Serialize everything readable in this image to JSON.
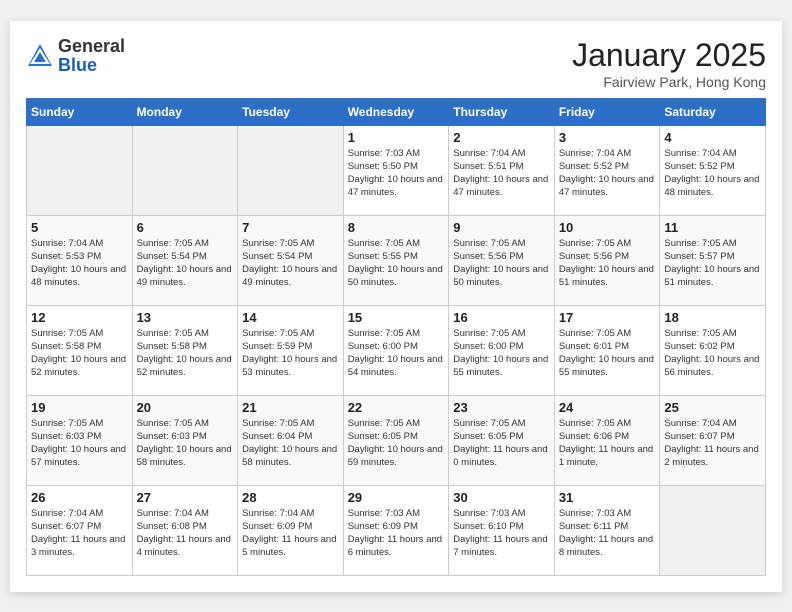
{
  "header": {
    "logo_general": "General",
    "logo_blue": "Blue",
    "month_year": "January 2025",
    "location": "Fairview Park, Hong Kong"
  },
  "days_of_week": [
    "Sunday",
    "Monday",
    "Tuesday",
    "Wednesday",
    "Thursday",
    "Friday",
    "Saturday"
  ],
  "weeks": [
    [
      {
        "day": "",
        "sunrise": "",
        "sunset": "",
        "daylight": ""
      },
      {
        "day": "",
        "sunrise": "",
        "sunset": "",
        "daylight": ""
      },
      {
        "day": "",
        "sunrise": "",
        "sunset": "",
        "daylight": ""
      },
      {
        "day": "1",
        "sunrise": "Sunrise: 7:03 AM",
        "sunset": "Sunset: 5:50 PM",
        "daylight": "Daylight: 10 hours and 47 minutes."
      },
      {
        "day": "2",
        "sunrise": "Sunrise: 7:04 AM",
        "sunset": "Sunset: 5:51 PM",
        "daylight": "Daylight: 10 hours and 47 minutes."
      },
      {
        "day": "3",
        "sunrise": "Sunrise: 7:04 AM",
        "sunset": "Sunset: 5:52 PM",
        "daylight": "Daylight: 10 hours and 47 minutes."
      },
      {
        "day": "4",
        "sunrise": "Sunrise: 7:04 AM",
        "sunset": "Sunset: 5:52 PM",
        "daylight": "Daylight: 10 hours and 48 minutes."
      }
    ],
    [
      {
        "day": "5",
        "sunrise": "Sunrise: 7:04 AM",
        "sunset": "Sunset: 5:53 PM",
        "daylight": "Daylight: 10 hours and 48 minutes."
      },
      {
        "day": "6",
        "sunrise": "Sunrise: 7:05 AM",
        "sunset": "Sunset: 5:54 PM",
        "daylight": "Daylight: 10 hours and 49 minutes."
      },
      {
        "day": "7",
        "sunrise": "Sunrise: 7:05 AM",
        "sunset": "Sunset: 5:54 PM",
        "daylight": "Daylight: 10 hours and 49 minutes."
      },
      {
        "day": "8",
        "sunrise": "Sunrise: 7:05 AM",
        "sunset": "Sunset: 5:55 PM",
        "daylight": "Daylight: 10 hours and 50 minutes."
      },
      {
        "day": "9",
        "sunrise": "Sunrise: 7:05 AM",
        "sunset": "Sunset: 5:56 PM",
        "daylight": "Daylight: 10 hours and 50 minutes."
      },
      {
        "day": "10",
        "sunrise": "Sunrise: 7:05 AM",
        "sunset": "Sunset: 5:56 PM",
        "daylight": "Daylight: 10 hours and 51 minutes."
      },
      {
        "day": "11",
        "sunrise": "Sunrise: 7:05 AM",
        "sunset": "Sunset: 5:57 PM",
        "daylight": "Daylight: 10 hours and 51 minutes."
      }
    ],
    [
      {
        "day": "12",
        "sunrise": "Sunrise: 7:05 AM",
        "sunset": "Sunset: 5:58 PM",
        "daylight": "Daylight: 10 hours and 52 minutes."
      },
      {
        "day": "13",
        "sunrise": "Sunrise: 7:05 AM",
        "sunset": "Sunset: 5:58 PM",
        "daylight": "Daylight: 10 hours and 52 minutes."
      },
      {
        "day": "14",
        "sunrise": "Sunrise: 7:05 AM",
        "sunset": "Sunset: 5:59 PM",
        "daylight": "Daylight: 10 hours and 53 minutes."
      },
      {
        "day": "15",
        "sunrise": "Sunrise: 7:05 AM",
        "sunset": "Sunset: 6:00 PM",
        "daylight": "Daylight: 10 hours and 54 minutes."
      },
      {
        "day": "16",
        "sunrise": "Sunrise: 7:05 AM",
        "sunset": "Sunset: 6:00 PM",
        "daylight": "Daylight: 10 hours and 55 minutes."
      },
      {
        "day": "17",
        "sunrise": "Sunrise: 7:05 AM",
        "sunset": "Sunset: 6:01 PM",
        "daylight": "Daylight: 10 hours and 55 minutes."
      },
      {
        "day": "18",
        "sunrise": "Sunrise: 7:05 AM",
        "sunset": "Sunset: 6:02 PM",
        "daylight": "Daylight: 10 hours and 56 minutes."
      }
    ],
    [
      {
        "day": "19",
        "sunrise": "Sunrise: 7:05 AM",
        "sunset": "Sunset: 6:03 PM",
        "daylight": "Daylight: 10 hours and 57 minutes."
      },
      {
        "day": "20",
        "sunrise": "Sunrise: 7:05 AM",
        "sunset": "Sunset: 6:03 PM",
        "daylight": "Daylight: 10 hours and 58 minutes."
      },
      {
        "day": "21",
        "sunrise": "Sunrise: 7:05 AM",
        "sunset": "Sunset: 6:04 PM",
        "daylight": "Daylight: 10 hours and 58 minutes."
      },
      {
        "day": "22",
        "sunrise": "Sunrise: 7:05 AM",
        "sunset": "Sunset: 6:05 PM",
        "daylight": "Daylight: 10 hours and 59 minutes."
      },
      {
        "day": "23",
        "sunrise": "Sunrise: 7:05 AM",
        "sunset": "Sunset: 6:05 PM",
        "daylight": "Daylight: 11 hours and 0 minutes."
      },
      {
        "day": "24",
        "sunrise": "Sunrise: 7:05 AM",
        "sunset": "Sunset: 6:06 PM",
        "daylight": "Daylight: 11 hours and 1 minute."
      },
      {
        "day": "25",
        "sunrise": "Sunrise: 7:04 AM",
        "sunset": "Sunset: 6:07 PM",
        "daylight": "Daylight: 11 hours and 2 minutes."
      }
    ],
    [
      {
        "day": "26",
        "sunrise": "Sunrise: 7:04 AM",
        "sunset": "Sunset: 6:07 PM",
        "daylight": "Daylight: 11 hours and 3 minutes."
      },
      {
        "day": "27",
        "sunrise": "Sunrise: 7:04 AM",
        "sunset": "Sunset: 6:08 PM",
        "daylight": "Daylight: 11 hours and 4 minutes."
      },
      {
        "day": "28",
        "sunrise": "Sunrise: 7:04 AM",
        "sunset": "Sunset: 6:09 PM",
        "daylight": "Daylight: 11 hours and 5 minutes."
      },
      {
        "day": "29",
        "sunrise": "Sunrise: 7:03 AM",
        "sunset": "Sunset: 6:09 PM",
        "daylight": "Daylight: 11 hours and 6 minutes."
      },
      {
        "day": "30",
        "sunrise": "Sunrise: 7:03 AM",
        "sunset": "Sunset: 6:10 PM",
        "daylight": "Daylight: 11 hours and 7 minutes."
      },
      {
        "day": "31",
        "sunrise": "Sunrise: 7:03 AM",
        "sunset": "Sunset: 6:11 PM",
        "daylight": "Daylight: 11 hours and 8 minutes."
      },
      {
        "day": "",
        "sunrise": "",
        "sunset": "",
        "daylight": ""
      }
    ]
  ]
}
